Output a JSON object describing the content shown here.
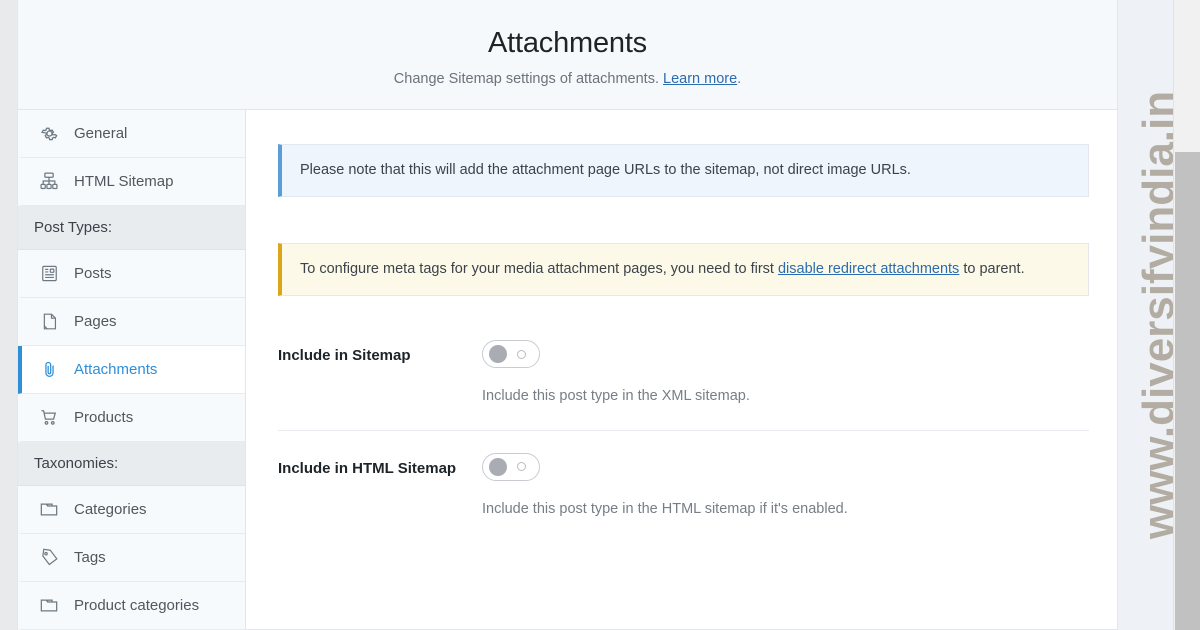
{
  "header": {
    "title": "Attachments",
    "subtitle_prefix": "Change Sitemap settings of attachments. ",
    "subtitle_link": "Learn more",
    "subtitle_suffix": "."
  },
  "sidebar": {
    "items": [
      {
        "label": "General",
        "icon": "gear-icon",
        "type": "item",
        "active": false
      },
      {
        "label": "HTML Sitemap",
        "icon": "sitemap-icon",
        "type": "item",
        "active": false
      },
      {
        "label": "Post Types:",
        "icon": "",
        "type": "group",
        "active": false
      },
      {
        "label": "Posts",
        "icon": "post-icon",
        "type": "item",
        "active": false
      },
      {
        "label": "Pages",
        "icon": "page-icon",
        "type": "item",
        "active": false
      },
      {
        "label": "Attachments",
        "icon": "paperclip-icon",
        "type": "item",
        "active": true
      },
      {
        "label": "Products",
        "icon": "cart-icon",
        "type": "item",
        "active": false
      },
      {
        "label": "Taxonomies:",
        "icon": "",
        "type": "group",
        "active": false
      },
      {
        "label": "Categories",
        "icon": "folder-icon",
        "type": "item",
        "active": false
      },
      {
        "label": "Tags",
        "icon": "tag-icon",
        "type": "item",
        "active": false
      },
      {
        "label": "Product categories",
        "icon": "folder-icon",
        "type": "item",
        "active": false
      }
    ]
  },
  "notices": {
    "info": {
      "text": "Please note that this will add the attachment page URLs to the sitemap, not direct image URLs."
    },
    "warning": {
      "text_before": "To configure meta tags for your media attachment pages, you need to first ",
      "link": "disable redirect attachments",
      "text_after": " to parent."
    }
  },
  "settings": [
    {
      "label": "Include in Sitemap",
      "toggle_state": "off",
      "description": "Include this post type in the XML sitemap."
    },
    {
      "label": "Include in HTML Sitemap",
      "toggle_state": "off",
      "description": "Include this post type in the HTML sitemap if it's enabled."
    }
  ],
  "watermark": {
    "text": "www.diversifyindia.in"
  },
  "colors": {
    "accent": "#2e8fd8",
    "link": "#2b6cb0",
    "notice_info_border": "#5b9dd9",
    "notice_warning_border": "#dba617"
  }
}
